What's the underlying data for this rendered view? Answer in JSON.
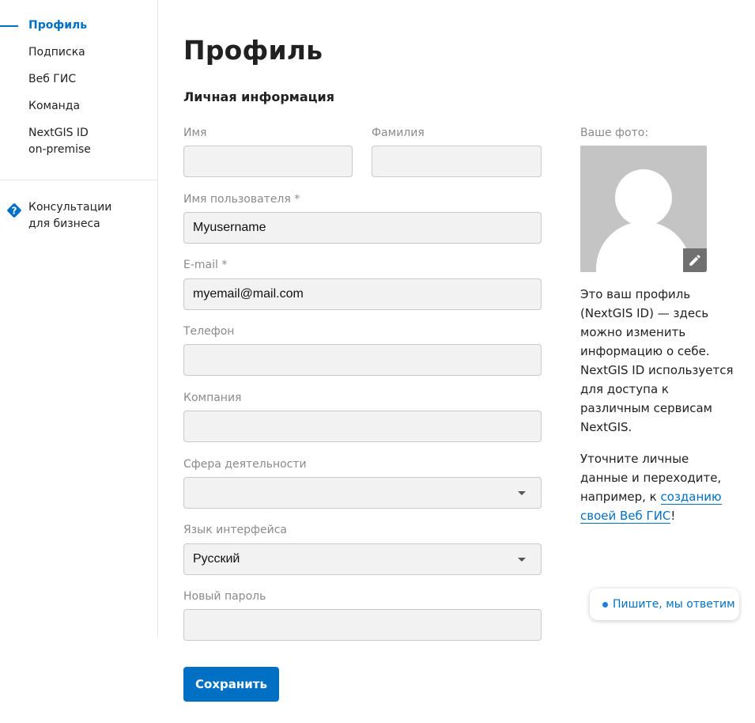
{
  "sidebar": {
    "items": [
      {
        "label": "Профиль",
        "active": true
      },
      {
        "label": "Подписка"
      },
      {
        "label": "Веб ГИС"
      },
      {
        "label": "Команда"
      },
      {
        "label_line1": "NextGIS ID",
        "label_line2": "on-premise"
      }
    ],
    "consult": {
      "line1": "Консультации",
      "line2": "для бизнеса",
      "icon": "question-diamond-icon"
    }
  },
  "page": {
    "title": "Профиль",
    "section": "Личная информация"
  },
  "form": {
    "first_name": {
      "label": "Имя",
      "value": ""
    },
    "last_name": {
      "label": "Фамилия",
      "value": ""
    },
    "username": {
      "label": "Имя пользователя *",
      "value": "Myusername"
    },
    "email": {
      "label": "E-mail *",
      "value": "myemail@mail.com"
    },
    "phone": {
      "label": "Телефон",
      "value": ""
    },
    "company": {
      "label": "Компания",
      "value": ""
    },
    "sphere": {
      "label": "Сфера деятельности",
      "value": ""
    },
    "language": {
      "label": "Язык интерфейса",
      "value": "Русский"
    },
    "password": {
      "label": "Новый пароль",
      "value": ""
    },
    "save_label": "Сохранить"
  },
  "photo": {
    "label": "Ваше фото:",
    "edit_icon": "pencil-icon"
  },
  "info": {
    "p1": "Это ваш профиль (NextGIS ID) — здесь можно изменить информацию о себе. NextGIS ID используется для доступа к различным сервисам NextGIS.",
    "p2_before": "Уточните личные данные и переходите, например, к ",
    "p2_link": "созданию своей Веб ГИС",
    "p2_after": "!"
  },
  "chat": {
    "label": "Пишите, мы ответим"
  },
  "colors": {
    "accent": "#0070c5",
    "field_bg": "#f2f2f2",
    "field_border": "#c9c9c9",
    "avatar_bg": "#c4c4c4"
  }
}
